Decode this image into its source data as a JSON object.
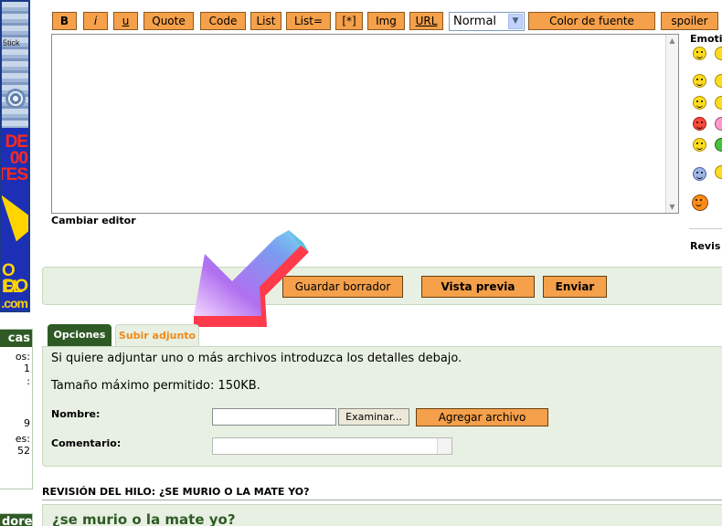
{
  "banner": {
    "text_top": "5tick",
    "text_mid": [
      "DE",
      "00",
      "TES"
    ],
    "text_bottom": [
      "O EL",
      "DO",
      ".com"
    ]
  },
  "sidebar": {
    "box1": {
      "title": "cas",
      "lines": [
        "os:",
        "1",
        ":",
        "",
        "9",
        "es:",
        "52"
      ]
    },
    "box2": {
      "title": "dores"
    }
  },
  "toolbar": {
    "buttons": [
      "B",
      "i",
      "u",
      "Quote",
      "Code",
      "List",
      "List=",
      "[*]",
      "Img",
      "URL"
    ],
    "font_size_value": "Normal",
    "font_color_label": "Color de fuente",
    "spoiler_label": "spoiler"
  },
  "editor": {
    "change_editor_label": "Cambiar editor"
  },
  "emoticons": {
    "title": "Emoti",
    "review_title": "Revis",
    "icons": [
      "smile-icon",
      "smile-icon",
      "smile-icon",
      "grin-icon",
      "angry-icon",
      "smile-icon",
      "blue-face-icon",
      "pumpkin-icon"
    ]
  },
  "actions": {
    "save_draft_label": "Guardar borrador",
    "preview_label": "Vista previa",
    "send_label": "Enviar"
  },
  "tabs": {
    "options_label": "Opciones",
    "attach_label": "Subir adjunto"
  },
  "attachment": {
    "intro": "Si quiere adjuntar uno o más archivos introduzca los detalles debajo.",
    "max_size": "Tamaño máximo permitido: 150KB.",
    "name_label": "Nombre:",
    "browse_label": "Examinar...",
    "add_file_label": "Agregar archivo",
    "comment_label": "Comentario:"
  },
  "review": {
    "heading": "REVISIÓN DEL HILO: ¿SE MURIO O LA MATE YO?",
    "thread_title": "¿se murio o la mate yo?"
  },
  "colors": {
    "accent_orange": "#f5a04a",
    "forum_green": "#2f5a26",
    "panel_green": "#e7f0e2"
  }
}
